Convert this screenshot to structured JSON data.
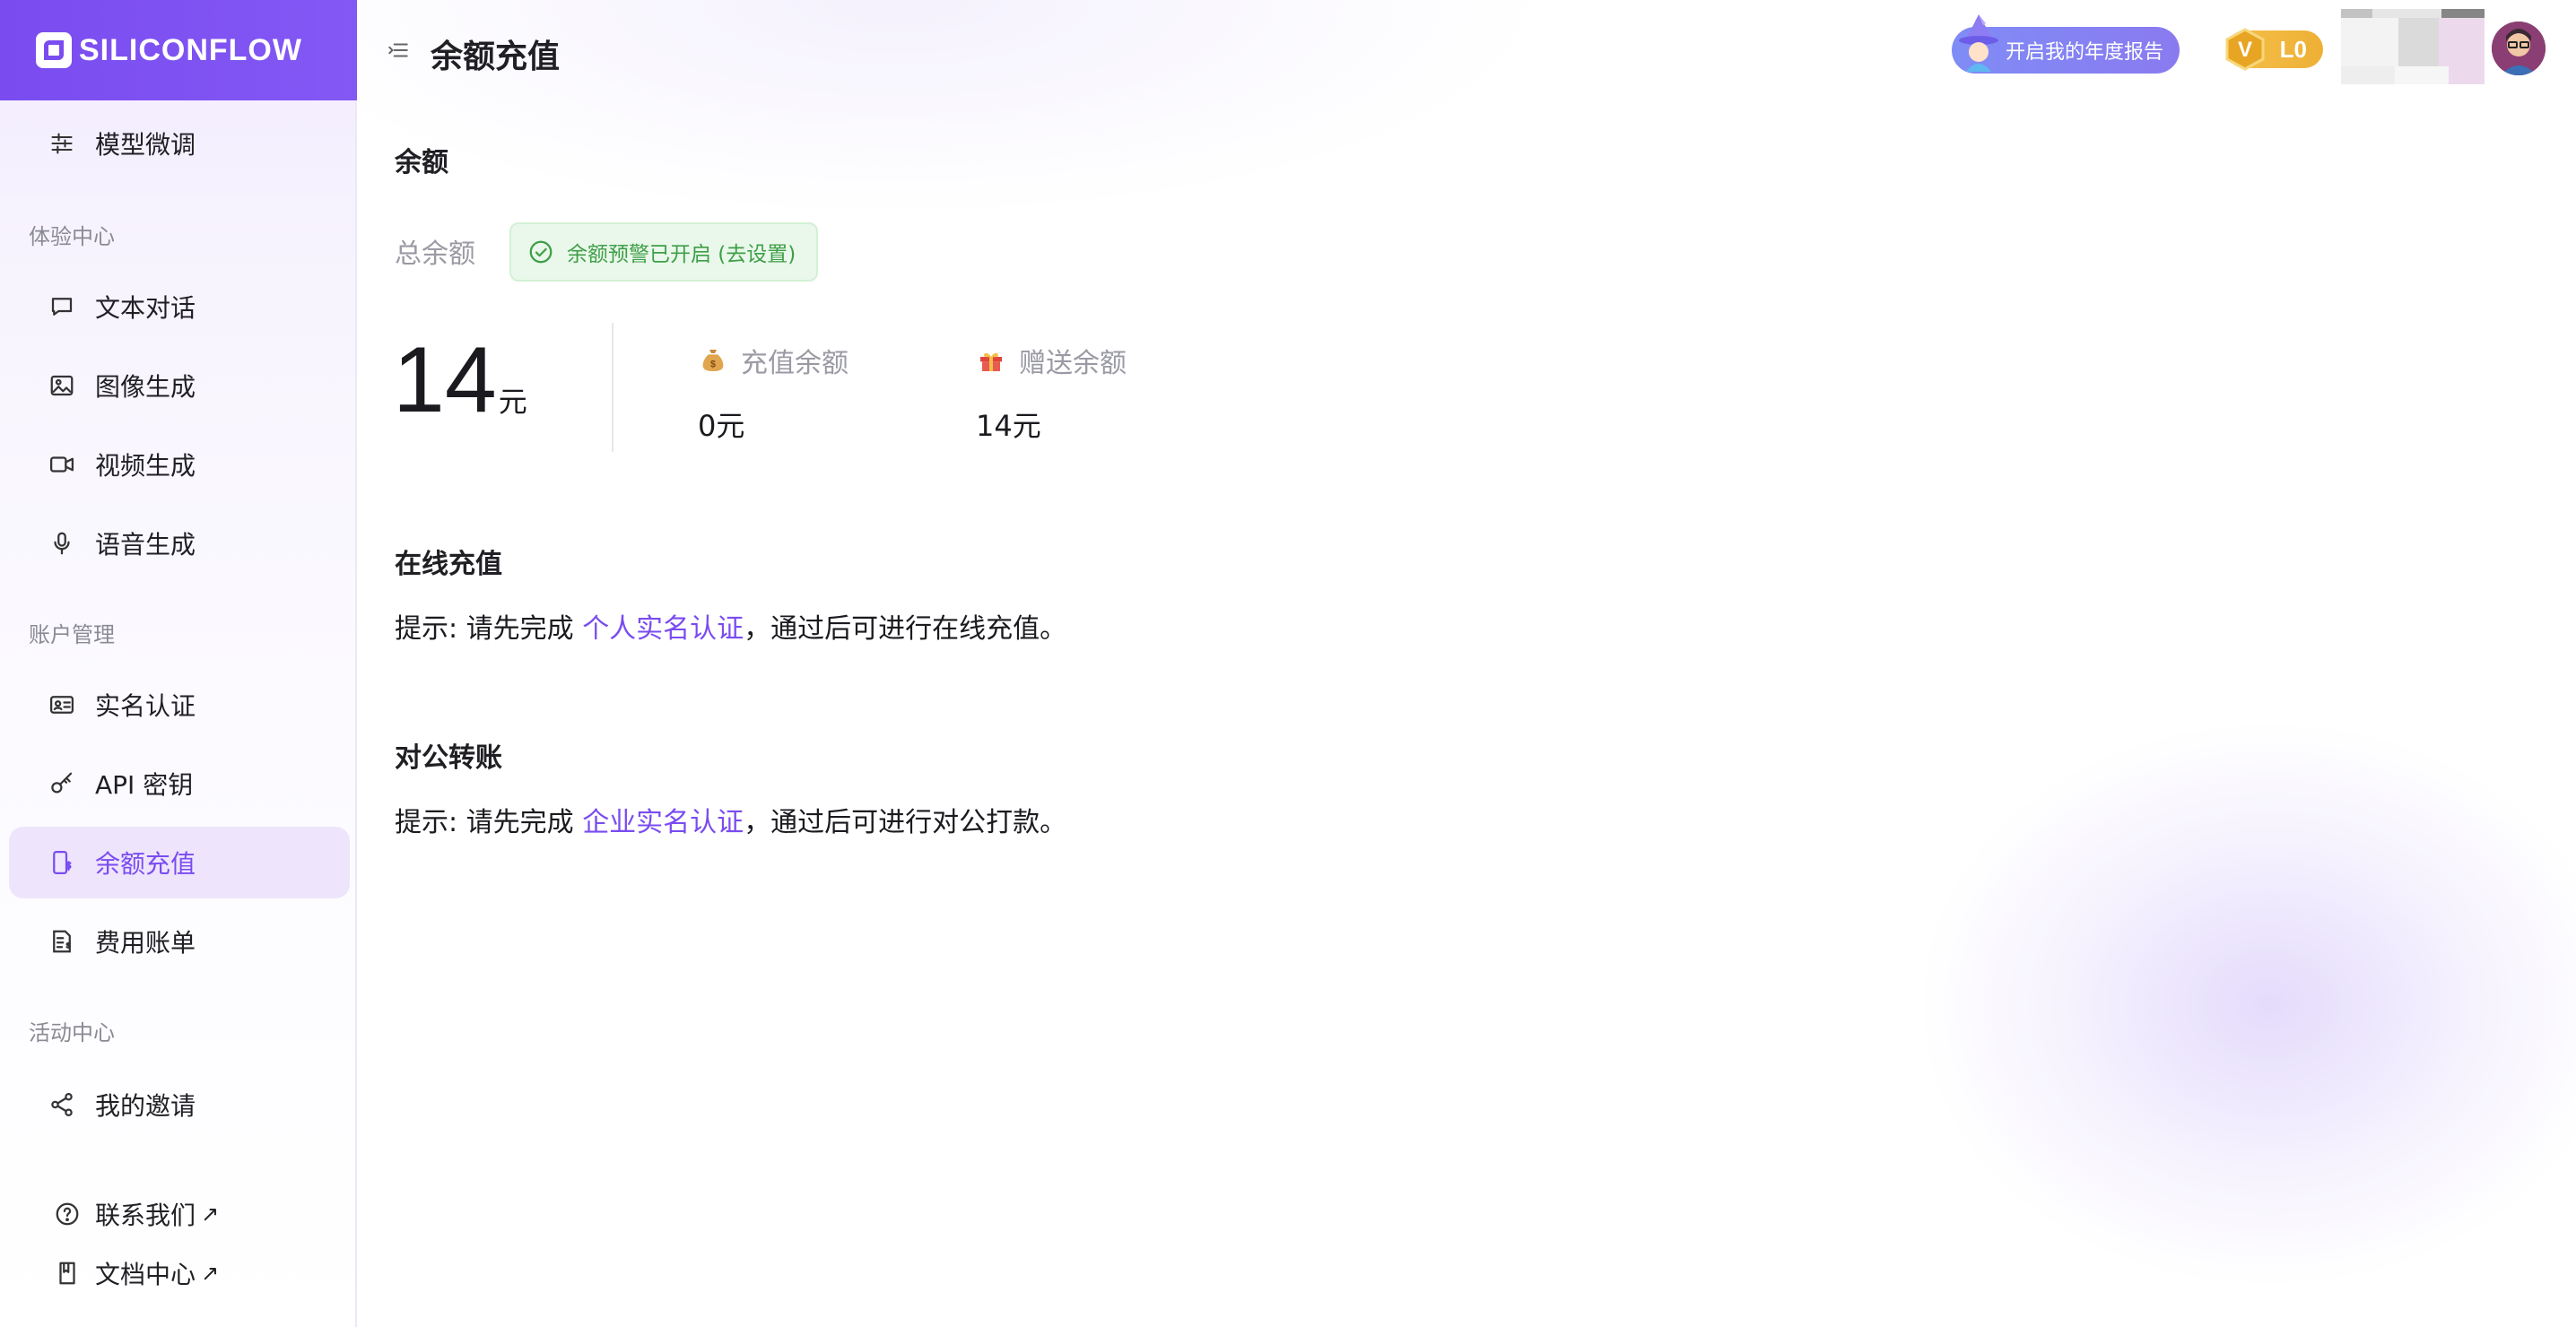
{
  "brand": {
    "logo_text": "SILICONFLOW"
  },
  "sidebar": {
    "top_item": {
      "label": "模型微调",
      "icon": "sliders-icon"
    },
    "sections": [
      {
        "title": "体验中心",
        "items": [
          {
            "label": "文本对话",
            "icon": "chat-bubble-icon"
          },
          {
            "label": "图像生成",
            "icon": "image-icon"
          },
          {
            "label": "视频生成",
            "icon": "video-camera-icon"
          },
          {
            "label": "语音生成",
            "icon": "microphone-icon"
          }
        ]
      },
      {
        "title": "账户管理",
        "items": [
          {
            "label": "实名认证",
            "icon": "id-card-icon"
          },
          {
            "label": "API 密钥",
            "icon": "key-icon"
          },
          {
            "label": "余额充值",
            "icon": "phone-dollar-icon",
            "active": true
          },
          {
            "label": "费用账单",
            "icon": "bill-icon"
          }
        ]
      },
      {
        "title": "活动中心",
        "items": [
          {
            "label": "我的邀请",
            "icon": "share-icon"
          }
        ]
      }
    ],
    "bottom_links": [
      {
        "label": "联系我们",
        "icon": "help-circle-icon",
        "external": "↗"
      },
      {
        "label": "文档中心",
        "icon": "book-icon",
        "external": "↗"
      }
    ]
  },
  "header": {
    "title": "余额充值",
    "report_button": "开启我的年度报告",
    "level_badge": "L0"
  },
  "balance": {
    "section_title": "余额",
    "total_label": "总余额",
    "alert_chip": "余额预警已开启 (去设置)",
    "total_amount": "14",
    "total_unit": "元",
    "recharge": {
      "label": "充值余额",
      "value": "0元",
      "icon": "money-bag-icon"
    },
    "gift": {
      "label": "赠送余额",
      "value": "14元",
      "icon": "gift-icon"
    }
  },
  "online_recharge": {
    "title": "在线充值",
    "tip_prefix": "提示: 请先完成 ",
    "tip_link": "个人实名认证",
    "tip_suffix": "，通过后可进行在线充值。"
  },
  "corporate_transfer": {
    "title": "对公转账",
    "tip_prefix": "提示: 请先完成 ",
    "tip_link": "企业实名认证",
    "tip_suffix": "，通过后可进行对公打款。"
  },
  "colors": {
    "brand": "#7a4cf0",
    "active_bg": "#eee5fd",
    "success_text": "#3f9e48",
    "level_gold": "#f5c04a"
  }
}
